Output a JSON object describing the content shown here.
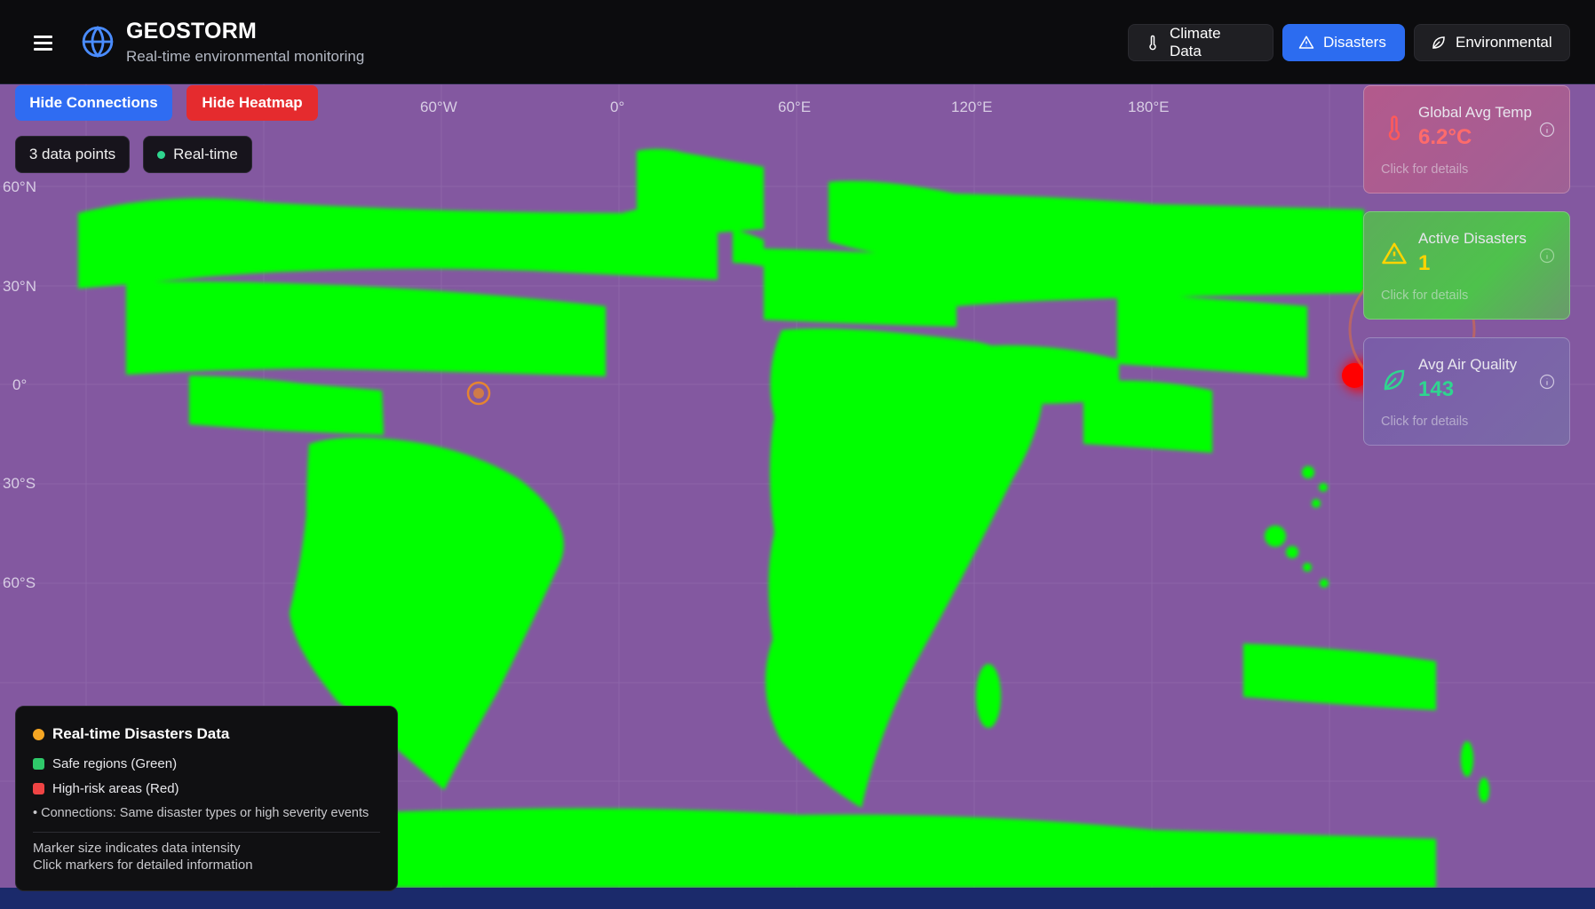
{
  "header": {
    "title": "GEOSTORM",
    "subtitle": "Real-time environmental monitoring",
    "nav": [
      {
        "label": "Climate Data",
        "icon": "thermometer-icon",
        "active": false
      },
      {
        "label": "Disasters",
        "icon": "warning-triangle-icon",
        "active": true
      },
      {
        "label": "Environmental",
        "icon": "leaf-icon",
        "active": false
      }
    ]
  },
  "controls": {
    "connections_label": "Hide Connections",
    "heatmap_label": "Hide Heatmap",
    "data_points": "3 data points",
    "realtime": "Real-time"
  },
  "map": {
    "lon_labels": [
      "60°W",
      "0°",
      "60°E",
      "120°E",
      "180°E"
    ],
    "lat_labels": [
      "60°N",
      "30°N",
      "0°",
      "30°S",
      "60°S"
    ],
    "colors": {
      "background": "#8358a0",
      "land": "#00ff00",
      "high_risk": "#ff0000",
      "marker": "#f08a24"
    }
  },
  "stats": [
    {
      "label": "Global Avg Temp",
      "value": "6.2°C",
      "hint": "Click for details",
      "icon": "thermometer-icon",
      "color": "#ff6b6b"
    },
    {
      "label": "Active Disasters",
      "value": "1",
      "hint": "Click for details",
      "icon": "warning-triangle-icon",
      "color": "#ffd400"
    },
    {
      "label": "Avg Air Quality",
      "value": "143",
      "hint": "Click for details",
      "icon": "leaf-icon",
      "color": "#2fd58f"
    }
  ],
  "legend": {
    "title": "Real-time Disasters Data",
    "safe": "Safe regions (Green)",
    "risk": "High-risk areas (Red)",
    "connections": "• Connections: Same disaster types or high severity events",
    "note1": "Marker size indicates data intensity",
    "note2": "Click markers for detailed information"
  }
}
